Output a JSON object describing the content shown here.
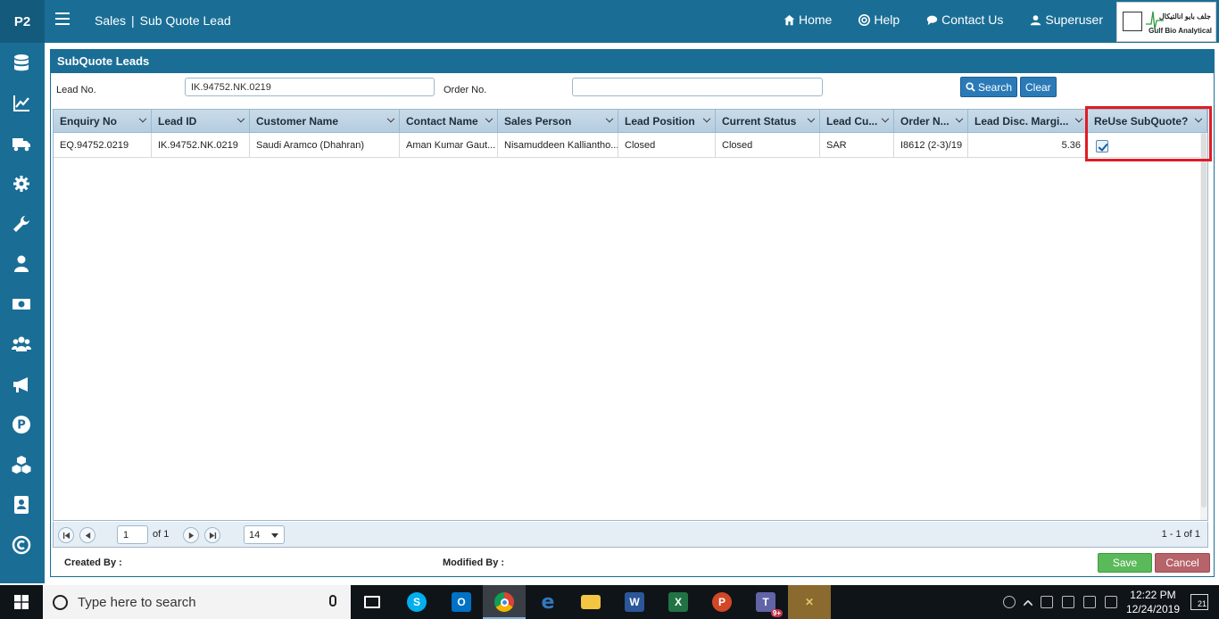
{
  "app": {
    "brand": "P2",
    "breadcrumb": {
      "module": "Sales",
      "separator": "|",
      "page": "Sub Quote Lead"
    },
    "nav": {
      "home": "Home",
      "help": "Help",
      "contact": "Contact Us",
      "user": "Superuser"
    },
    "logo": {
      "arabic_text": "جلف بايو انالتيكال",
      "english_text": "Gulf Bio Analytical"
    }
  },
  "sidebar": {
    "icons": [
      "database-icon",
      "chart-line-icon",
      "truck-icon",
      "gear-icon",
      "wrench-icon",
      "user-icon",
      "money-icon",
      "users-icon",
      "megaphone-icon",
      "parking-icon",
      "cubes-icon",
      "address-book-icon",
      "copyright-icon"
    ]
  },
  "panel": {
    "title": "SubQuote Leads",
    "filters": {
      "lead_no_label": "Lead No.",
      "lead_no_value": "IK.94752.NK.0219",
      "order_no_label": "Order No.",
      "order_no_value": "",
      "search_label": "Search",
      "clear_label": "Clear"
    },
    "grid": {
      "columns": [
        "Enquiry No",
        "Lead ID",
        "Customer Name",
        "Contact Name",
        "Sales Person",
        "Lead Position",
        "Current Status",
        "Lead Cu...",
        "Order N...",
        "Lead Disc. Margi...",
        "ReUse SubQuote?"
      ],
      "rows": [
        {
          "enquiry_no": "EQ.94752.0219",
          "lead_id": "IK.94752.NK.0219",
          "customer_name": "Saudi Aramco (Dhahran)",
          "contact_name": "Aman Kumar Gaut...",
          "sales_person": "Nisamuddeen Kalliantho...",
          "lead_position": "Closed",
          "current_status": "Closed",
          "lead_currency": "SAR",
          "order_no": "I8612 (2-3)/19",
          "lead_disc_margin": "5.36",
          "reuse_subquote": true
        }
      ]
    },
    "pager": {
      "page": "1",
      "of_label": "of 1",
      "page_size": "14",
      "info": "1 - 1 of 1"
    },
    "footer": {
      "created_by_label": "Created By :",
      "modified_by_label": "Modified By :",
      "save_label": "Save",
      "cancel_label": "Cancel"
    }
  },
  "taskbar": {
    "search_placeholder": "Type here to search",
    "time": "12:22 PM",
    "date": "12/24/2019",
    "notifications": "21",
    "apps": [
      "task-view-icon",
      "skype-icon",
      "outlook-icon",
      "chrome-icon",
      "edge-icon",
      "file-explorer-icon",
      "word-icon",
      "excel-icon",
      "powerpoint-icon",
      "teams-icon",
      "tools-icon"
    ],
    "teams_badge": "9+"
  },
  "colors": {
    "primary": "#1a6e96",
    "highlight": "#e01b24",
    "save": "#5ab95a",
    "cancel": "#b7636a"
  }
}
